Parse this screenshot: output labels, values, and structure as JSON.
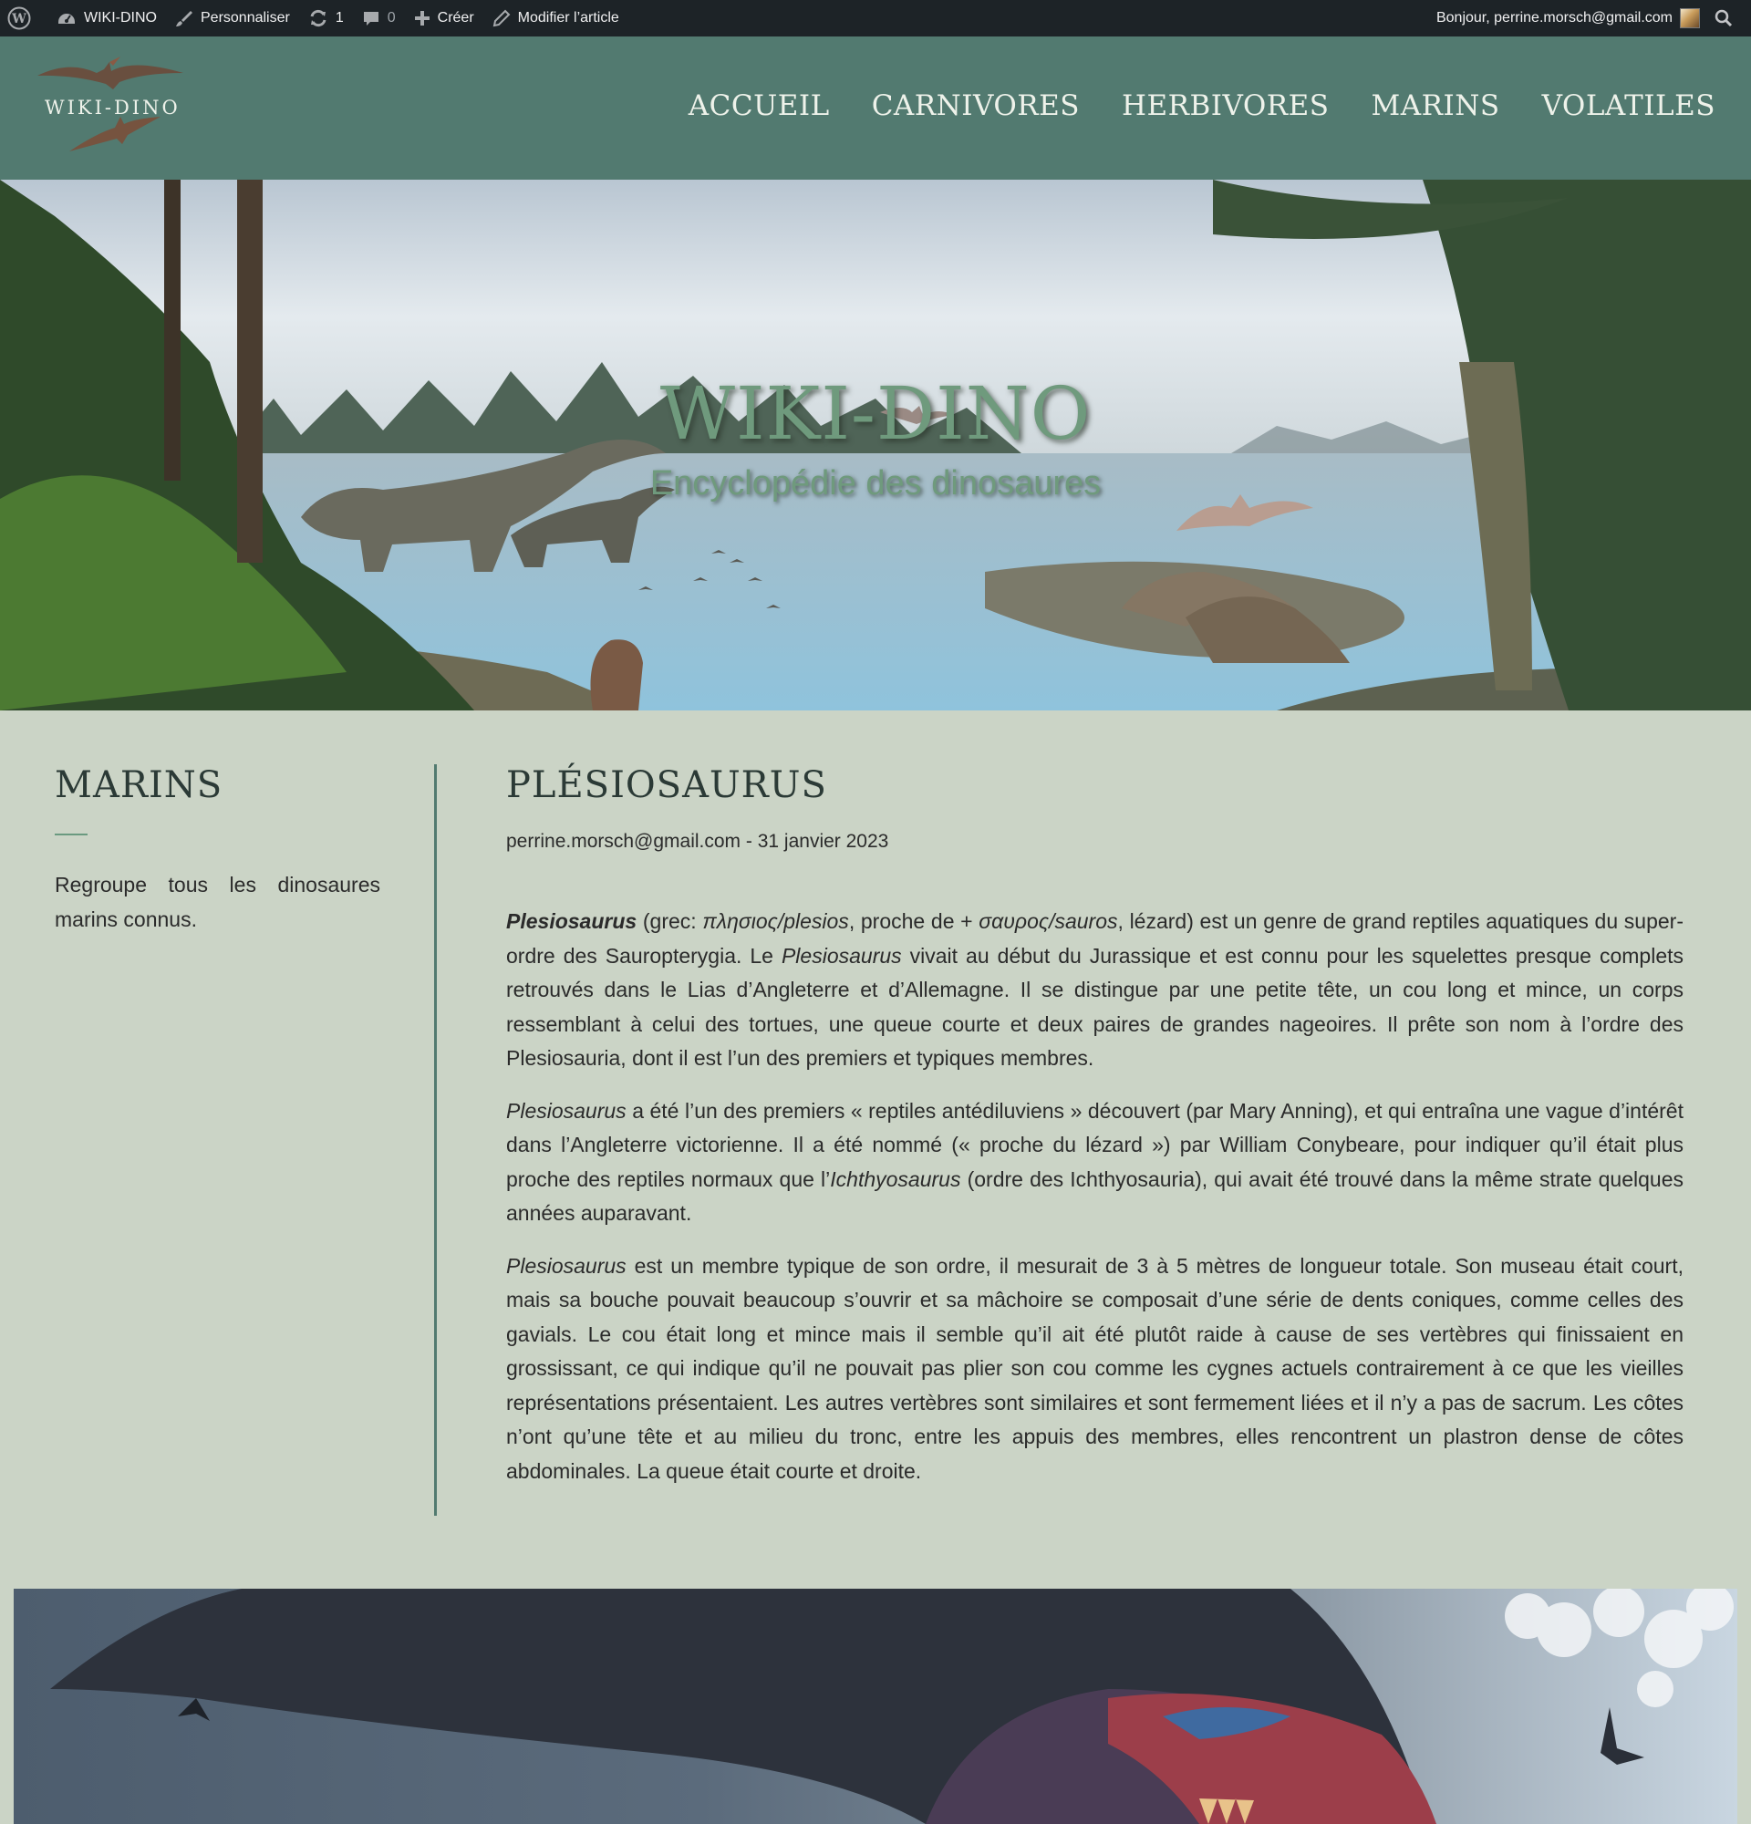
{
  "admin_bar": {
    "site_name": "WIKI-DINO",
    "customize": "Personnaliser",
    "updates_count": "1",
    "comments_count": "0",
    "new_label": "Créer",
    "edit_post": "Modifier l’article",
    "greeting": "Bonjour, perrine.morsch@gmail.com"
  },
  "header": {
    "logo_text": "WIKI-DINO",
    "nav": [
      "ACCUEIL",
      "CARNIVORES",
      "HERBIVORES",
      "MARINS",
      "VOLATILES"
    ]
  },
  "hero": {
    "title": "WIKI-DINO",
    "subtitle": "Encyclopédie des dinosaures"
  },
  "sidebar": {
    "title": "MARINS",
    "description": "Regroupe tous les dinosaures marins connus."
  },
  "article": {
    "title": "PLÉSIOSAURUS",
    "author": "perrine.morsch@gmail.com",
    "date": "31 janvier 2023",
    "meta_separator": " - ",
    "p1": {
      "name": "Plesiosaurus",
      "t1": " (grec: ",
      "greek1": "πλησιος/plesios",
      "t2": ", proche de + ",
      "greek2": "σαυρος/sauros",
      "t3": ", lézard) est un genre de grand reptiles aquatiques du super-ordre des Sauropterygia. Le ",
      "name2": "Plesiosaurus",
      "t4": " vivait au début du Jurassique et est connu pour les squelettes presque complets retrouvés dans le Lias d’Angleterre et d’Allemagne. Il se distingue par une petite tête, un cou long et mince, un corps ressemblant à celui des tortues, une queue courte et deux paires de grandes nageoires. Il prête son nom à l’ordre des Plesiosauria, dont il est l’un des premiers et typiques membres."
    },
    "p2": {
      "name": "Plesiosaurus",
      "t1": " a été l’un des premiers « reptiles antédiluviens » découvert (par Mary Anning), et qui entraîna une vague d’intérêt dans l’Angleterre victorienne. Il a été nommé (« proche du lézard ») par William Conybeare, pour indiquer qu’il était plus proche des reptiles normaux que l’",
      "name2": "Ichthyosaurus",
      "t2": " (ordre des Ichthyosauria), qui avait été trouvé dans la même strate quelques années auparavant."
    },
    "p3": {
      "name": "Plesiosaurus",
      "t1": " est un membre typique de son ordre, il mesurait de 3 à 5 mètres de longueur totale. Son museau était court, mais sa bouche pouvait beaucoup s’ouvrir et sa mâchoire se composait d’une série de dents coniques, comme celles des gavials. Le cou était long et mince mais il semble qu’il ait été plutôt raide à cause de ses vertèbres qui finissaient en grossissant, ce qui indique qu’il ne pouvait pas plier son cou comme les cygnes actuels contrairement à ce que les vieilles représentations présentaient. Les autres vertèbres sont similaires et sont fermement liées et il n’y a pas de sacrum. Les côtes n’ont qu’une tête et au milieu du tronc, entre les appuis des membres, elles rencontrent un plastron dense de côtes abdominales. La queue était courte et droite."
    }
  },
  "icons": {
    "wordpress": "wordpress-icon",
    "dashboard": "dashboard-icon",
    "customize": "brush-icon",
    "updates": "refresh-icon",
    "comments": "comment-icon",
    "new": "plus-icon",
    "edit": "pencil-icon",
    "search": "search-icon"
  },
  "colors": {
    "admin_bar": "#1d2327",
    "header": "#527a70",
    "page_bg": "#cbd4c6",
    "hero_text": "#6f9a7d"
  }
}
